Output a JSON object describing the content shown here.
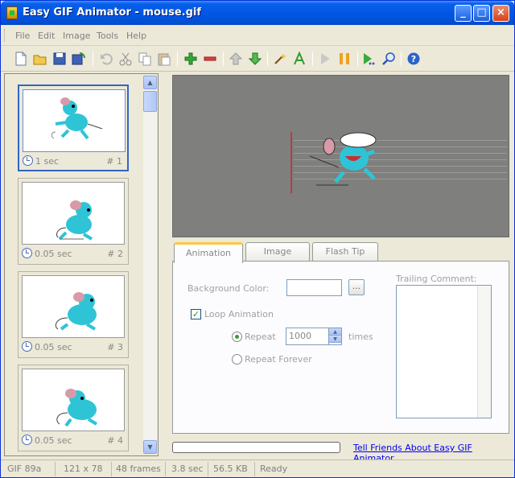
{
  "window": {
    "title": "Easy GIF Animator - mouse.gif"
  },
  "menu": [
    "File",
    "Edit",
    "Image",
    "Tools",
    "Help"
  ],
  "frames": [
    {
      "delay": "1 sec",
      "number": "# 1"
    },
    {
      "delay": "0.05 sec",
      "number": "# 2"
    },
    {
      "delay": "0.05 sec",
      "number": "# 3"
    },
    {
      "delay": "0.05 sec",
      "number": "# 4"
    }
  ],
  "tabs": [
    "Animation",
    "Image",
    "Flash Tip"
  ],
  "animation": {
    "background_color_label": "Background Color:",
    "browse_label": "...",
    "loop_label": "Loop Animation",
    "loop_checked": true,
    "repeat_label": "Repeat",
    "repeat_value": "1000",
    "times_label": "times",
    "repeat_forever_label": "Repeat Forever",
    "trailing_comment_label": "Trailing Comment:"
  },
  "progress": {
    "fraction": 0.0
  },
  "link": "Tell Friends About Easy GIF Animator",
  "status": [
    "GIF 89a",
    "121 x 78",
    "48 frames",
    "3.8 sec",
    "56.5 KB",
    "Ready"
  ],
  "colors": {
    "titlebar": "#0058e6",
    "loop_check": "#21a121",
    "preview_bg": "#7f7f7d",
    "link": "#0000ee"
  }
}
